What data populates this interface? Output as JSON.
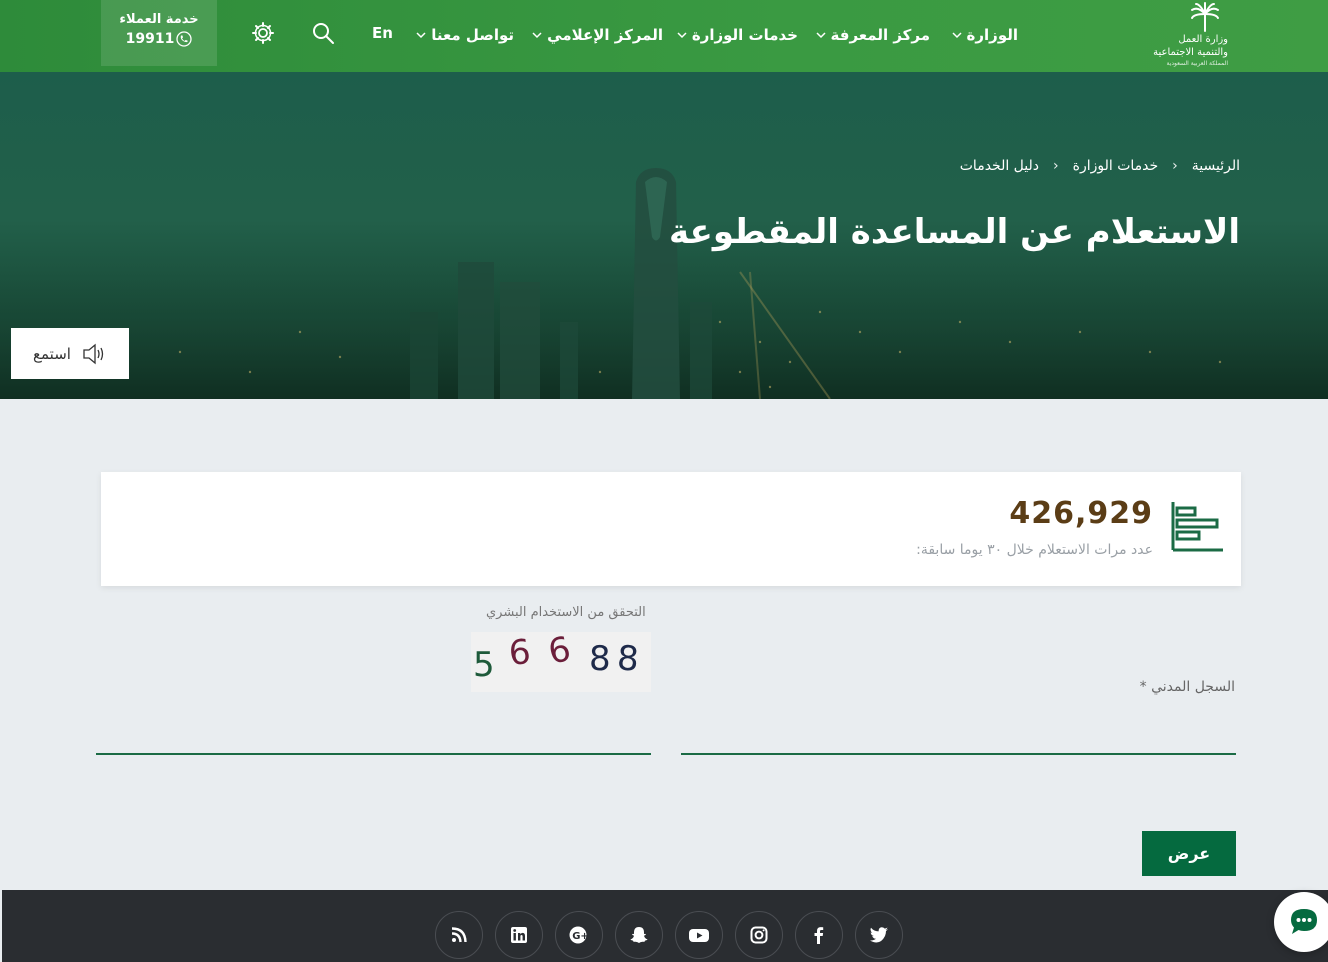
{
  "header": {
    "logo": {
      "line1": "وزارة العمل",
      "line2": "والتنمية الاجتماعية",
      "line3": "المملكة العربية السعودية"
    },
    "nav": [
      {
        "label": "الوزارة"
      },
      {
        "label": "مركز المعرفة"
      },
      {
        "label": "خدمات الوزارة"
      },
      {
        "label": "المركز الإعلامي"
      },
      {
        "label": "تواصل معنا"
      }
    ],
    "lang": "En",
    "support": {
      "title": "خدمة العملاء",
      "phone": "19911"
    }
  },
  "hero": {
    "breadcrumb": [
      "الرئيسية",
      "خدمات الوزارة",
      "دليل الخدمات"
    ],
    "title": "الاستعلام عن المساعدة المقطوعة",
    "listen_label": "استمع"
  },
  "stats": {
    "count": "426,929",
    "description": "عدد مرات الاستعلام خلال ٣٠ يوما سابقة:"
  },
  "form": {
    "captcha_label": "التحقق من الاستخدام البشري",
    "captcha_digits": [
      "5",
      "6",
      "6",
      "8",
      "8"
    ],
    "civil_id_label": "السجل المدني *",
    "civil_id_value": "",
    "captcha_value": "",
    "submit_label": "عرض"
  },
  "footer": {
    "social": [
      "twitter-icon",
      "facebook-icon",
      "instagram-icon",
      "youtube-icon",
      "snapchat-icon",
      "google-plus-icon",
      "linkedin-icon",
      "rss-icon"
    ]
  },
  "colors": {
    "primary": "#3a9a42",
    "accent": "#056a3f",
    "count": "#5b3d16",
    "footer": "#2a2d31"
  }
}
